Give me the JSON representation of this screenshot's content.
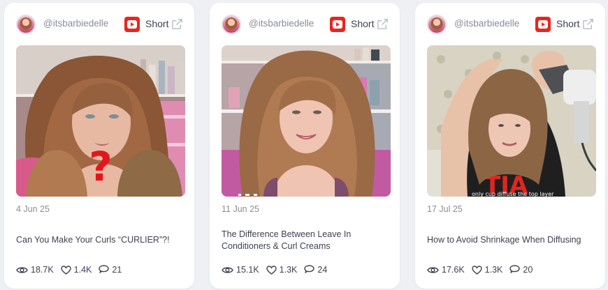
{
  "cards": [
    {
      "handle": "@itsbarbiedelle",
      "type_label": "Short",
      "platform_icon": "youtube-icon",
      "date": "4 Jun 25",
      "title": "Can You Make Your Curls “CURLIER”?!",
      "views": "18.7K",
      "likes": "1.4K",
      "comments": "21",
      "thumbnail_overlay": "?"
    },
    {
      "handle": "@itsbarbiedelle",
      "type_label": "Short",
      "platform_icon": "youtube-icon",
      "date": "11 Jun 25",
      "title": "The Difference Between Leave In Conditioners & Curl Creams",
      "views": "15.1K",
      "likes": "1.3K",
      "comments": "24"
    },
    {
      "handle": "@itsbarbiedelle",
      "type_label": "Short",
      "platform_icon": "youtube-icon",
      "date": "17 Jul 25",
      "title": "How to Avoid Shrinkage When Diffusing",
      "views": "17.6K",
      "likes": "1.3K",
      "comments": "20",
      "thumbnail_caption": "only cup diffuse the top layer",
      "thumbnail_shirt_text": "TIA"
    }
  ],
  "icons": {
    "views": "eye-icon",
    "likes": "heart-icon",
    "comments": "speech-bubble-icon",
    "external": "external-link-icon"
  },
  "colors": {
    "youtube_red": "#e8261f",
    "text_primary": "#3e4150",
    "text_muted": "#8a8d96",
    "page_background": "#eef0f4"
  }
}
